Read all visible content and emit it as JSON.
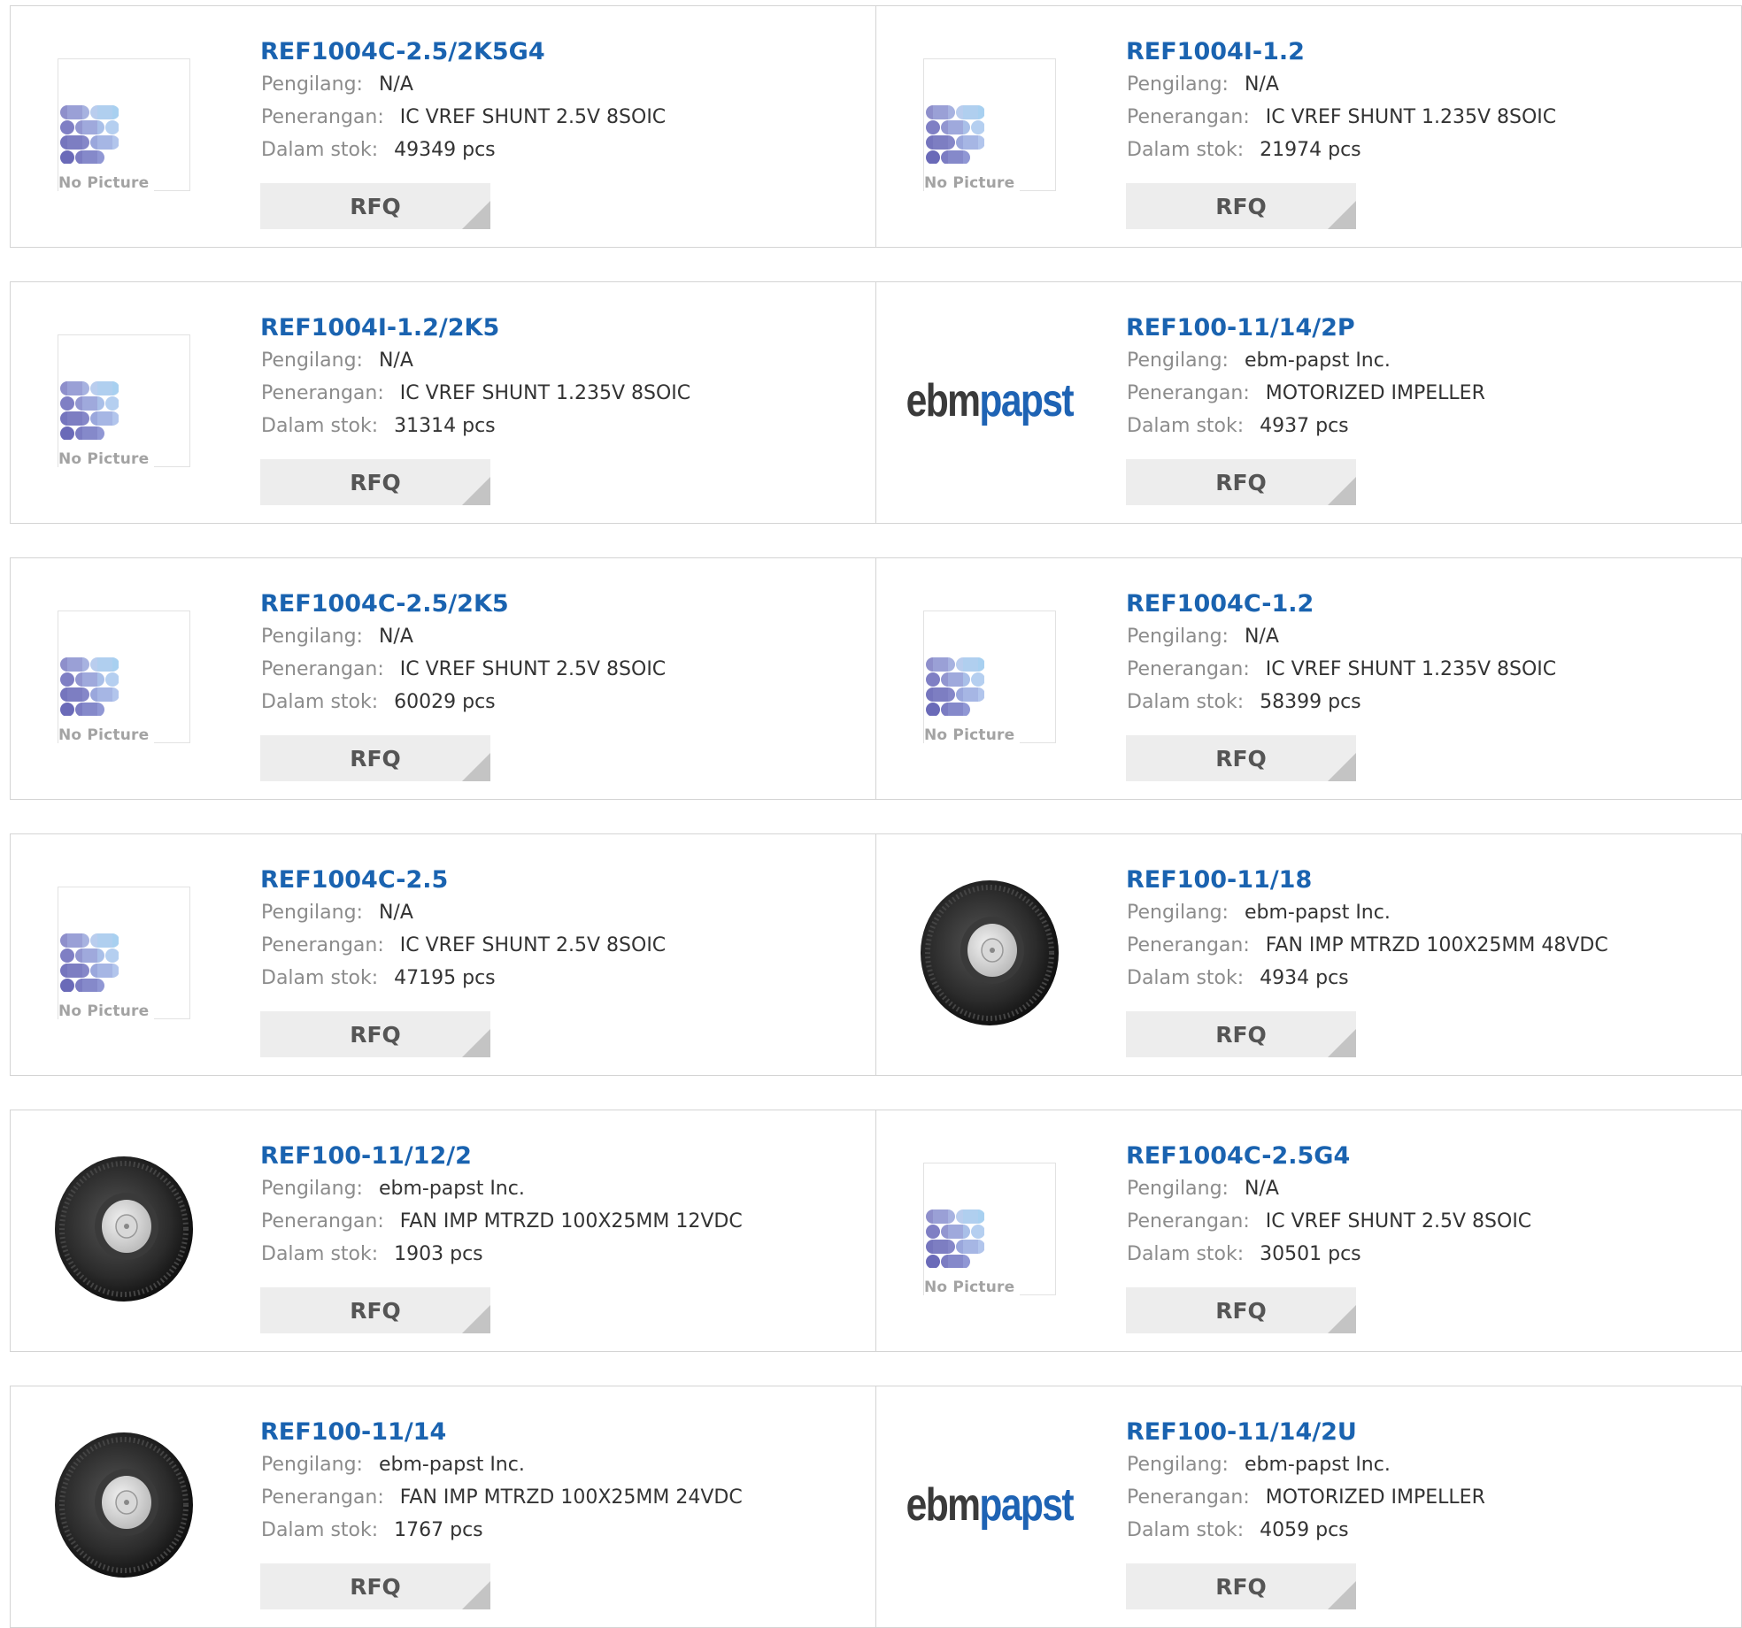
{
  "labels": {
    "manufacturer": "Pengilang:",
    "description": "Penerangan:",
    "stock": "Dalam stok:",
    "rfq": "RFQ",
    "no_picture": "No Picture"
  },
  "brand_logo": {
    "part1": "ebm",
    "part2": "papst"
  },
  "colors": {
    "title": "#1a63b0",
    "logo_dark": "#3a3a3a",
    "logo_blue": "#1e63b4",
    "button_bg": "#ededed"
  },
  "products": [
    {
      "part": "REF1004C-2.5/2K5G4",
      "manufacturer": "N/A",
      "description": "IC VREF SHUNT 2.5V 8SOIC",
      "stock": "49349 pcs",
      "image": "no-picture"
    },
    {
      "part": "REF1004I-1.2",
      "manufacturer": "N/A",
      "description": "IC VREF SHUNT 1.235V 8SOIC",
      "stock": "21974 pcs",
      "image": "no-picture"
    },
    {
      "part": "REF1004I-1.2/2K5",
      "manufacturer": "N/A",
      "description": "IC VREF SHUNT 1.235V 8SOIC",
      "stock": "31314 pcs",
      "image": "no-picture"
    },
    {
      "part": "REF100-11/14/2P",
      "manufacturer": "ebm-papst Inc.",
      "description": "MOTORIZED IMPELLER",
      "stock": "4937 pcs",
      "image": "ebmpapst-logo"
    },
    {
      "part": "REF1004C-2.5/2K5",
      "manufacturer": "N/A",
      "description": "IC VREF SHUNT 2.5V 8SOIC",
      "stock": "60029 pcs",
      "image": "no-picture"
    },
    {
      "part": "REF1004C-1.2",
      "manufacturer": "N/A",
      "description": "IC VREF SHUNT 1.235V 8SOIC",
      "stock": "58399 pcs",
      "image": "no-picture"
    },
    {
      "part": "REF1004C-2.5",
      "manufacturer": "N/A",
      "description": "IC VREF SHUNT 2.5V 8SOIC",
      "stock": "47195 pcs",
      "image": "no-picture"
    },
    {
      "part": "REF100-11/18",
      "manufacturer": "ebm-papst Inc.",
      "description": "FAN IMP MTRZD 100X25MM 48VDC",
      "stock": "4934 pcs",
      "image": "fan-impeller"
    },
    {
      "part": "REF100-11/12/2",
      "manufacturer": "ebm-papst Inc.",
      "description": "FAN IMP MTRZD 100X25MM 12VDC",
      "stock": "1903 pcs",
      "image": "fan-impeller"
    },
    {
      "part": "REF1004C-2.5G4",
      "manufacturer": "N/A",
      "description": "IC VREF SHUNT 2.5V 8SOIC",
      "stock": "30501 pcs",
      "image": "no-picture"
    },
    {
      "part": "REF100-11/14",
      "manufacturer": "ebm-papst Inc.",
      "description": "FAN IMP MTRZD 100X25MM 24VDC",
      "stock": "1767 pcs",
      "image": "fan-impeller"
    },
    {
      "part": "REF100-11/14/2U",
      "manufacturer": "ebm-papst Inc.",
      "description": "MOTORIZED IMPELLER",
      "stock": "4059 pcs",
      "image": "ebmpapst-logo"
    }
  ]
}
